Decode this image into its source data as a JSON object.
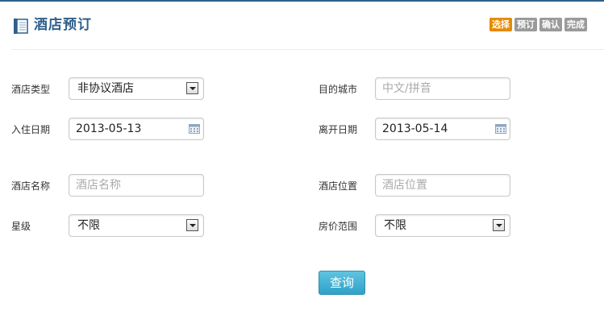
{
  "header": {
    "title": "酒店预订",
    "icon": "book-icon",
    "steps": [
      "选择",
      "预订",
      "确认",
      "完成"
    ],
    "active_step_color": "#e68a00",
    "accent_color": "#2e5f8a"
  },
  "form": {
    "hotel_type": {
      "label": "酒店类型",
      "value": "非协议酒店"
    },
    "dest_city": {
      "label": "目的城市",
      "placeholder": "中文/拼音"
    },
    "checkin": {
      "label": "入住日期",
      "value": "2013-05-13"
    },
    "checkout": {
      "label": "离开日期",
      "value": "2013-05-14"
    },
    "hotel_name": {
      "label": "酒店名称",
      "placeholder": "酒店名称"
    },
    "hotel_location": {
      "label": "酒店位置",
      "placeholder": "酒店位置"
    },
    "star": {
      "label": "星级",
      "value": "不限"
    },
    "price_range": {
      "label": "房价范围",
      "value": "不限"
    }
  },
  "actions": {
    "query_label": "查询",
    "query_color": "#2fa2c9"
  }
}
